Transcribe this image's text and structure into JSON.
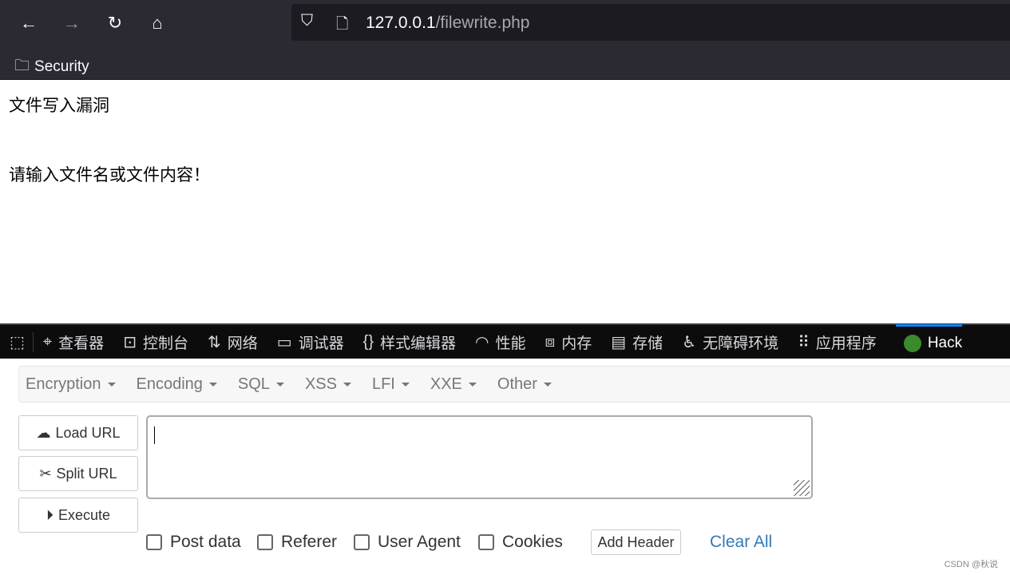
{
  "browser": {
    "url_host": "127.0.0.1",
    "url_path": "/filewrite.php",
    "bookmark": "Security"
  },
  "page": {
    "title": "文件写入漏洞",
    "message": "请输入文件名或文件内容！"
  },
  "devtools": {
    "tabs": [
      {
        "icon": "inspector-icon",
        "label": "查看器"
      },
      {
        "icon": "console-icon",
        "label": "控制台"
      },
      {
        "icon": "network-icon",
        "label": "网络"
      },
      {
        "icon": "debugger-icon",
        "label": "调试器"
      },
      {
        "icon": "style-editor-icon",
        "label": "样式编辑器"
      },
      {
        "icon": "performance-icon",
        "label": "性能"
      },
      {
        "icon": "memory-icon",
        "label": "内存"
      },
      {
        "icon": "storage-icon",
        "label": "存储"
      },
      {
        "icon": "accessibility-icon",
        "label": "无障碍环境"
      },
      {
        "icon": "application-icon",
        "label": "应用程序"
      }
    ],
    "active": "Hack"
  },
  "hackbar": {
    "menus": [
      "Encryption",
      "Encoding",
      "SQL",
      "XSS",
      "LFI",
      "XXE",
      "Other"
    ],
    "load": "Load URL",
    "split": "Split URL",
    "execute": "Execute",
    "url_value": "",
    "options": [
      "Post data",
      "Referer",
      "User Agent",
      "Cookies"
    ],
    "add_header": "Add Header",
    "clear_all": "Clear All"
  },
  "watermark": "CSDN @秋说"
}
